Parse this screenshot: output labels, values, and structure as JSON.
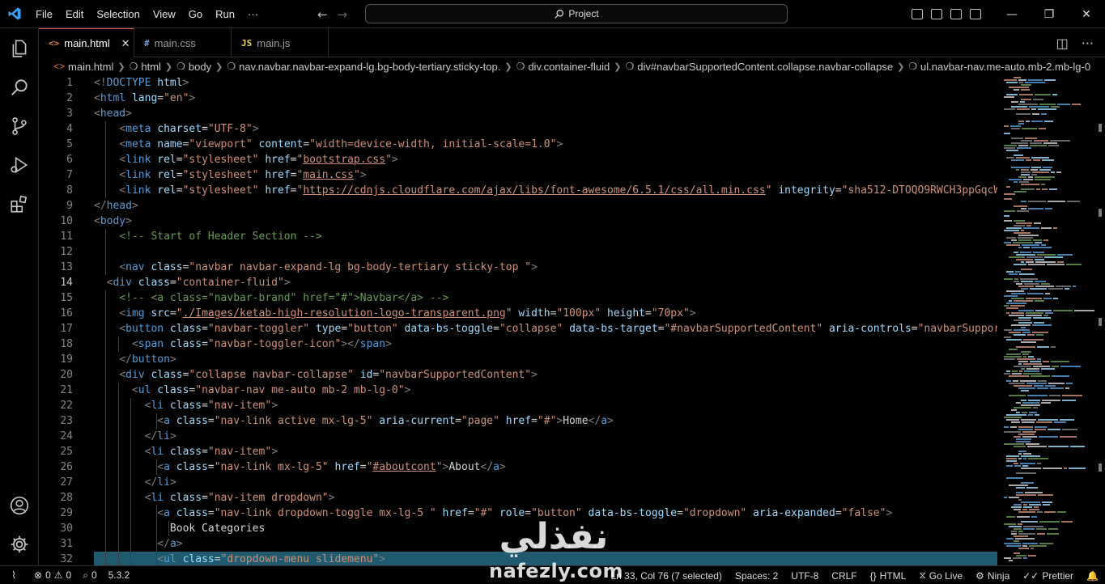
{
  "titlebar": {
    "menu": [
      "File",
      "Edit",
      "Selection",
      "View",
      "Go",
      "Run",
      "···"
    ],
    "command_center": "Project"
  },
  "tabs": [
    {
      "label": "main.html",
      "icon": "<>",
      "icon_color": "#e37933",
      "active": true
    },
    {
      "label": "main.css",
      "icon": "#",
      "icon_color": "#7b9ad6",
      "active": false
    },
    {
      "label": "main.js",
      "icon": "JS",
      "icon_color": "#e8d44d",
      "active": false
    }
  ],
  "breadcrumb": [
    "main.html",
    "html",
    "body",
    "nav.navbar.navbar-expand-lg.bg-body-tertiary.sticky-top.",
    "div.container-fluid",
    "div#navbarSupportedContent.collapse.navbar-collapse",
    "ul.navbar-nav.me-auto.mb-2.mb-lg-0"
  ],
  "editor": {
    "line_numbers": [
      "1",
      "2",
      "3",
      "4",
      "5",
      "6",
      "7",
      "8",
      "9",
      "10",
      "11",
      "12",
      "13",
      "14",
      "15",
      "16",
      "17",
      "18",
      "19",
      "20",
      "21",
      "22",
      "23",
      "24",
      "25",
      "26",
      "27",
      "28",
      "29",
      "30",
      "31",
      "32"
    ],
    "current_line": "33"
  },
  "statusbar": {
    "errors": "0",
    "warnings": "0",
    "ports": "0",
    "version": "5.3.2",
    "position": "Ln 33, Col 76 (7 selected)",
    "spaces": "Spaces: 2",
    "encoding": "UTF-8",
    "eol": "CRLF",
    "language": "HTML",
    "golive": "Go Live",
    "ninja": "Ninja",
    "prettier": "Prettier"
  },
  "watermark": {
    "arabic": "نفذلي",
    "latin": "nafezly.com"
  },
  "colors": {
    "accent_tab": "#e25d3b",
    "tag": "#569cd6",
    "attr": "#9cdcfe",
    "string": "#ce9178",
    "comment": "#6a9955"
  }
}
